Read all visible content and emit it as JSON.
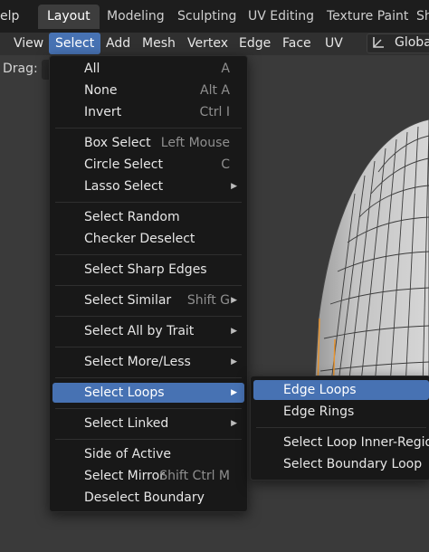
{
  "topbar": {
    "menu_fragment": "elp",
    "tabs": [
      {
        "label": "Layout",
        "active": true
      },
      {
        "label": "Modeling"
      },
      {
        "label": "Sculpting"
      },
      {
        "label": "UV Editing"
      },
      {
        "label": "Texture Paint"
      },
      {
        "label": "Sh"
      }
    ]
  },
  "header": {
    "items": [
      {
        "label": "View"
      },
      {
        "label": "Select",
        "active": true
      },
      {
        "label": "Add"
      },
      {
        "label": "Mesh"
      },
      {
        "label": "Vertex"
      },
      {
        "label": "Edge"
      },
      {
        "label": "Face"
      },
      {
        "label": "UV"
      }
    ],
    "transform_icon": "transform-orientation-icon",
    "transform_label": "Global"
  },
  "tool_header": {
    "drag_label": "Drag:"
  },
  "select_menu": {
    "items": [
      {
        "label": "All",
        "shortcut": "A"
      },
      {
        "label": "None",
        "shortcut": "Alt A"
      },
      {
        "label": "Invert",
        "shortcut": "Ctrl I"
      },
      {
        "label": "Box Select",
        "shortcut": "Left Mouse"
      },
      {
        "label": "Circle Select",
        "shortcut": "C"
      },
      {
        "label": "Lasso Select",
        "submenu": true
      },
      {
        "label": "Select Random"
      },
      {
        "label": "Checker Deselect"
      },
      {
        "label": "Select Sharp Edges"
      },
      {
        "label": "Select Similar",
        "shortcut": "Shift G",
        "submenu": true
      },
      {
        "label": "Select All by Trait",
        "submenu": true
      },
      {
        "label": "Select More/Less",
        "submenu": true
      },
      {
        "label": "Select Loops",
        "submenu": true,
        "highlighted": true
      },
      {
        "label": "Select Linked",
        "submenu": true
      },
      {
        "label": "Side of Active"
      },
      {
        "label": "Select Mirror",
        "shortcut": "Shift Ctrl M"
      },
      {
        "label": "Deselect Boundary"
      }
    ],
    "arrow_glyph": "▶"
  },
  "loops_submenu": {
    "items": [
      {
        "label": "Edge Loops",
        "highlighted": true
      },
      {
        "label": "Edge Rings"
      },
      {
        "label": "Select Loop Inner-Region"
      },
      {
        "label": "Select Boundary Loop"
      }
    ]
  },
  "colors": {
    "accent": "#4772b3",
    "menu_bg": "#181818",
    "viewport_bg": "#3a3a3a",
    "mesh_fill": "#b9b9b9",
    "mesh_wire": "#3c3c3c",
    "selected_edge": "#e8922a"
  }
}
